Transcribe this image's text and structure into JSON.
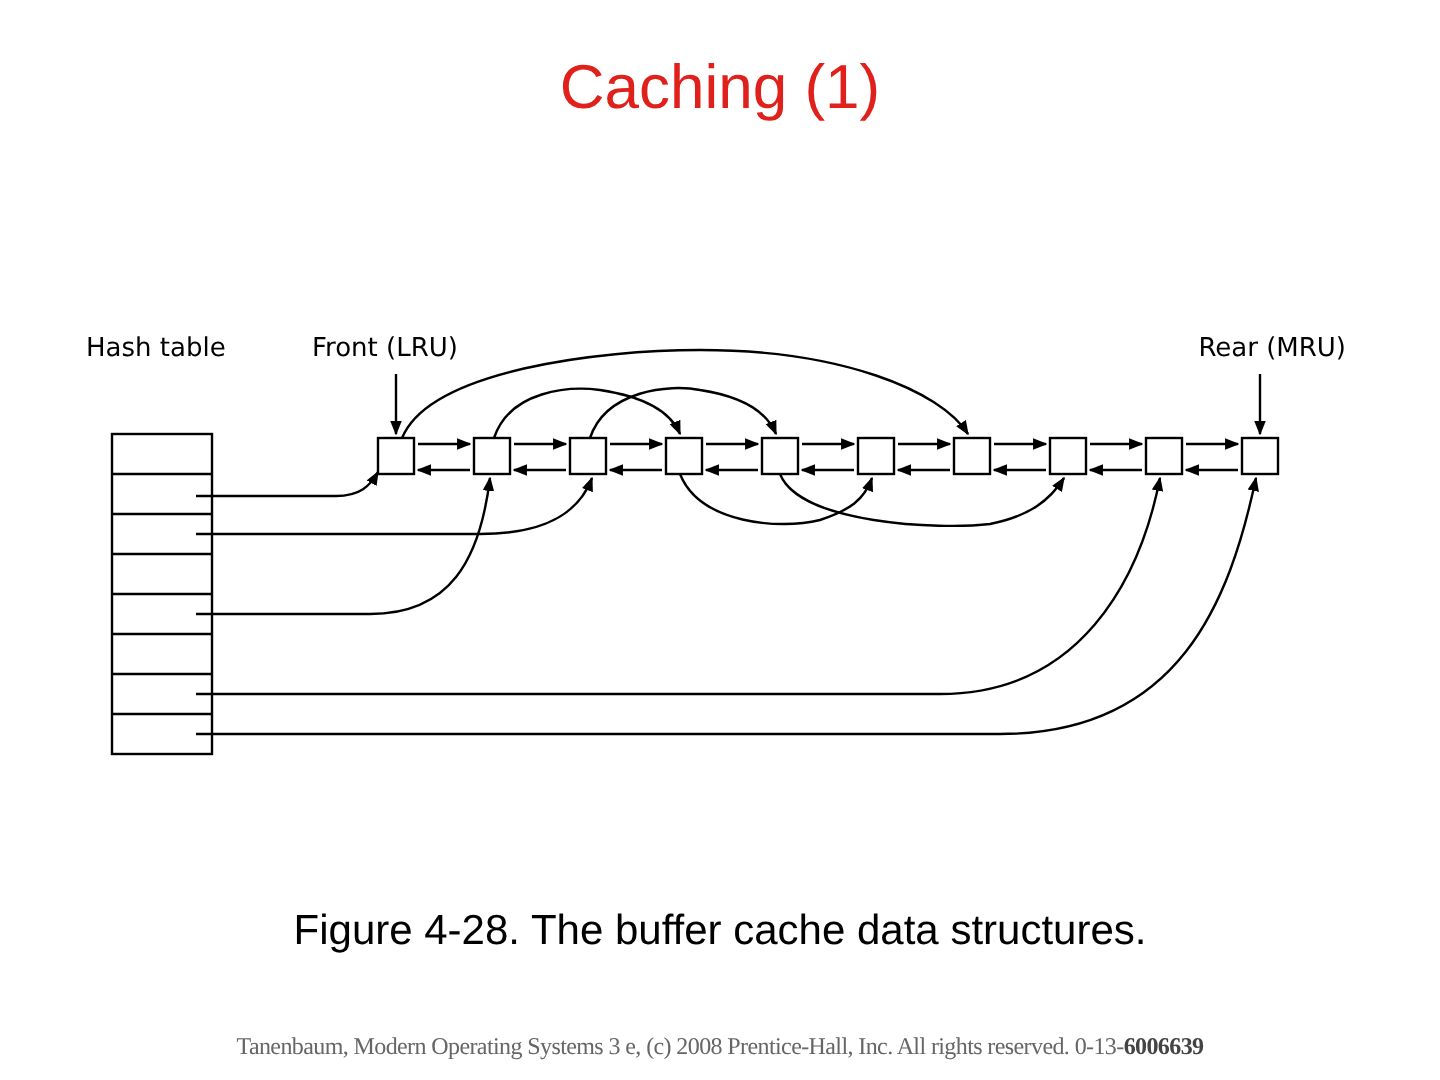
{
  "title": "Caching (1)",
  "figure": {
    "hash_table_label": "Hash table",
    "front_label": "Front (LRU)",
    "rear_label": "Rear (MRU)"
  },
  "caption": "Figure 4-28. The buffer cache data structures.",
  "footer": "Tanenbaum, Modern Operating Systems 3 e, (c) 2008 Prentice-Hall, Inc. All rights reserved. 0-13-**6006639**"
}
